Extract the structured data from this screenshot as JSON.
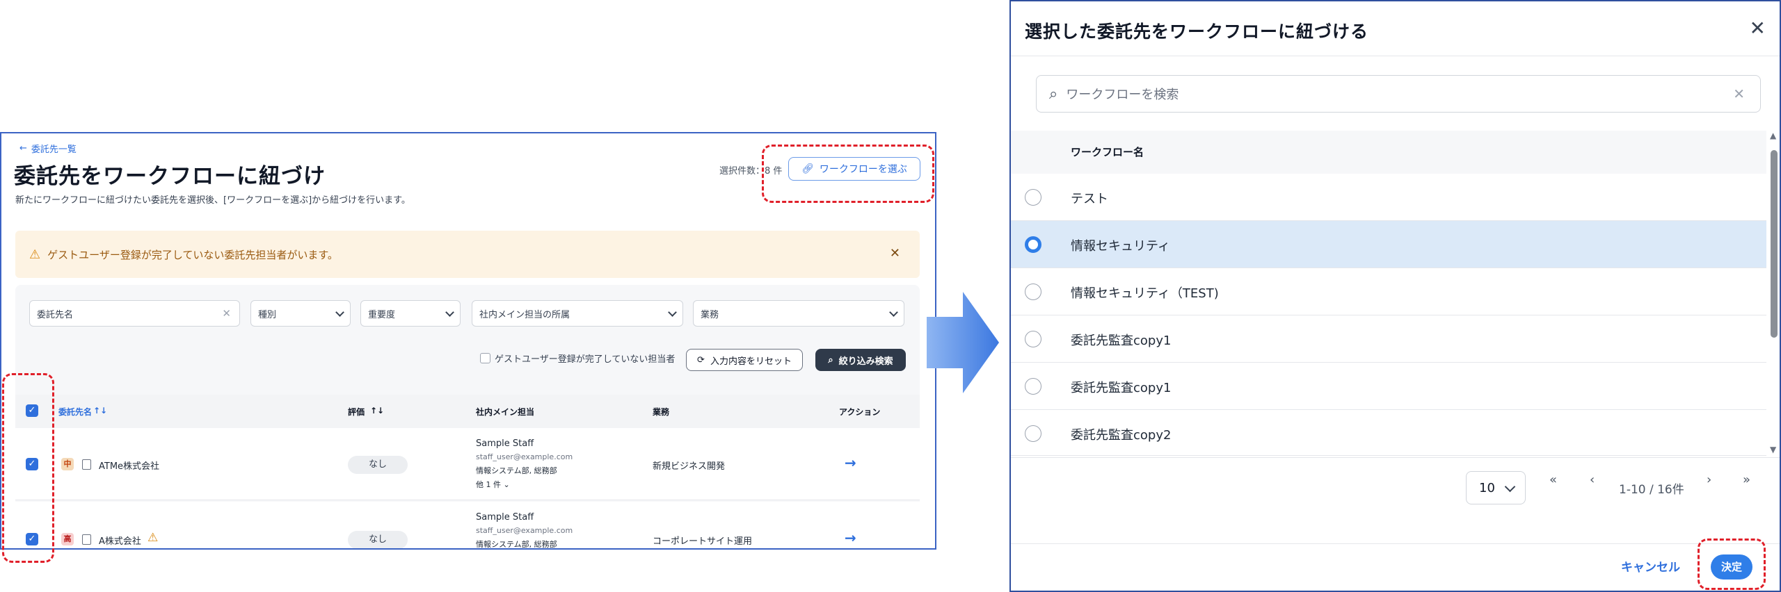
{
  "left_screen": {
    "back_link": "委託先一覧",
    "title": "委託先をワークフローに紐づけ",
    "description": "新たにワークフローに紐づけたい委託先を選択後、[ワークフローを選ぶ]から紐づけを行います。",
    "selected_count": "選択件数：8 件",
    "choose_workflow_button": "ワークフローを選ぶ",
    "warning": "ゲストユーザー登録が完了していない委託先担当者がいます。",
    "filters": {
      "name_placeholder": "委託先名",
      "type": "種別",
      "importance": "重要度",
      "department": "社内メイン担当の所属",
      "business": "業務"
    },
    "guest_filter_label": "ゲストユーザー登録が完了していない担当者",
    "reset_button": "入力内容をリセット",
    "search_button": "絞り込み検索",
    "columns": [
      "委託先名",
      "評価",
      "社内メイン担当",
      "業務",
      "アクション"
    ],
    "rows": [
      {
        "priority": "中",
        "priority_color": "#f4d9b8",
        "name": "ATMe株式会社",
        "rating": "なし",
        "staff_name": "Sample Staff",
        "staff_email": "staff_user@example.com",
        "staff_dept": "情報システム部, 総務部",
        "more": "他 1 件",
        "business": "新規ビジネス開発"
      },
      {
        "priority": "高",
        "priority_color": "#f8cfcf",
        "name": "A株式会社",
        "rating": "なし",
        "staff_name": "Sample Staff",
        "staff_email": "staff_user@example.com",
        "staff_dept": "情報システム部, 総務部",
        "business": "コーポレートサイト運用"
      }
    ]
  },
  "dialog": {
    "title": "選択した委託先をワークフローに紐づける",
    "search_placeholder": "ワークフローを検索",
    "column_header": "ワークフロー名",
    "options": [
      {
        "label": "テスト",
        "selected": false
      },
      {
        "label": "情報セキュリティ",
        "selected": true
      },
      {
        "label": "情報セキュリティ（TEST)",
        "selected": false
      },
      {
        "label": "委託先監査copy1",
        "selected": false
      },
      {
        "label": "委託先監査copy1",
        "selected": false
      },
      {
        "label": "委託先監査copy2",
        "selected": false
      }
    ],
    "per_page": "10",
    "page_info": "1-10 / 16件",
    "cancel_button": "キャンセル",
    "confirm_button": "決定"
  },
  "colors": {
    "accent": "#2f6fdc",
    "highlight_row": "#dbe9f8",
    "annotation": "#e0202a",
    "arrow": "#4a86e8"
  }
}
